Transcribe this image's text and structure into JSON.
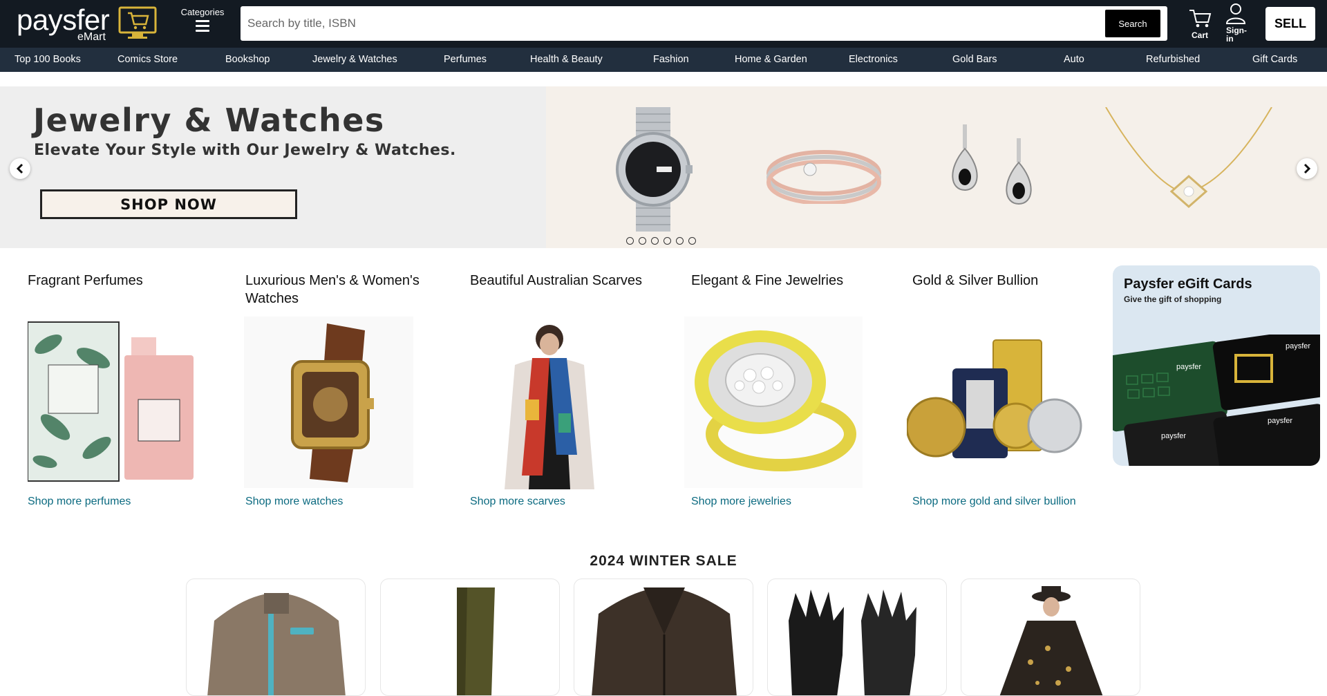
{
  "header": {
    "logo_word": "paysfer",
    "logo_sub": "eMart",
    "categories_label": "Categories",
    "search_placeholder": "Search by title, ISBN",
    "search_button": "Search",
    "cart_label": "Cart",
    "signin_label": "Sign-in",
    "sell_label": "SELL"
  },
  "nav": {
    "items": [
      "Top 100 Books",
      "Comics Store",
      "Bookshop",
      "Jewelry & Watches",
      "Perfumes",
      "Health & Beauty",
      "Fashion",
      "Home & Garden",
      "Electronics",
      "Gold Bars",
      "Auto",
      "Refurbished",
      "Gift Cards"
    ]
  },
  "banner": {
    "title": "Jewelry & Watches",
    "subtitle": "Elevate Your Style with Our Jewelry & Watches.",
    "cta": "SHOP NOW",
    "slide_count": 6
  },
  "categories": [
    {
      "title": "Fragrant Perfumes",
      "link": "Shop more perfumes",
      "icon": "perfume-image"
    },
    {
      "title": "Luxurious Men's & Women's Watches",
      "link": "Shop more watches",
      "icon": "watch-image"
    },
    {
      "title": "Beautiful Australian Scarves",
      "link": "Shop more scarves",
      "icon": "scarf-image"
    },
    {
      "title": "Elegant & Fine Jewelries",
      "link": "Shop more jewelries",
      "icon": "ring-image"
    },
    {
      "title": "Gold & Silver Bullion",
      "link": "Shop more gold and silver bullion",
      "icon": "bullion-image"
    }
  ],
  "gift_card": {
    "title": "Paysfer eGift Cards",
    "subtitle": "Give the gift of shopping",
    "card_brand": "paysfer"
  },
  "sale": {
    "title": "2024 WINTER SALE",
    "items": [
      "sweater-image",
      "boot-image",
      "leather-jacket-image",
      "gloves-image",
      "poncho-image"
    ]
  },
  "colors": {
    "header_bg": "#131a22",
    "nav_bg": "#222f3e",
    "link": "#0b6a80",
    "accent_gold": "#d8b43a"
  }
}
